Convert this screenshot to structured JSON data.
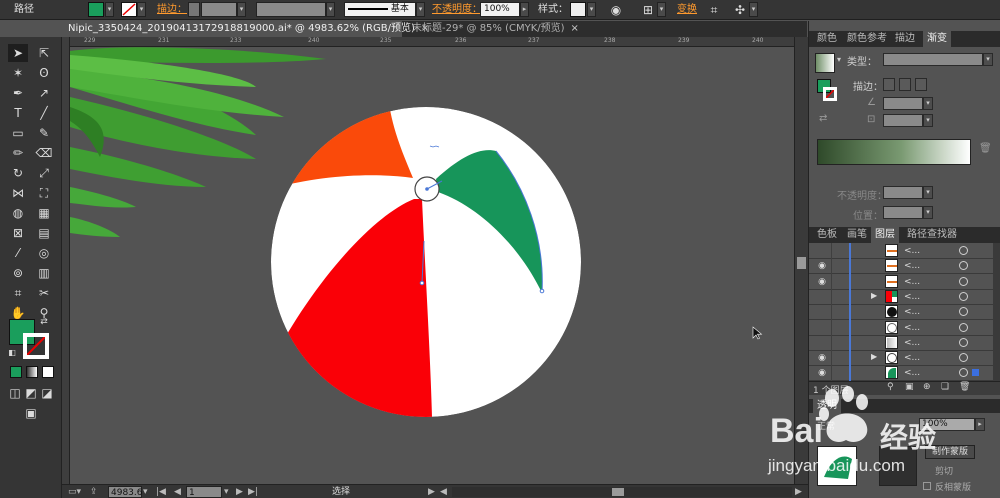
{
  "control_bar": {
    "object_type": "路径",
    "stroke_label": "描边：",
    "stroke_style": "基本",
    "opacity_label": "不透明度：",
    "opacity_value": "100%",
    "style_label": "样式：",
    "transform_label": "变换",
    "fill_color": "#1a9e5c"
  },
  "doc_tabs": [
    {
      "label": "Nipic_3350424_20190413172918819000.ai* @ 4983.62% (RGB/预览)",
      "close": "×"
    },
    {
      "label": "未标题-29* @ 85% (CMYK/预览)",
      "close": "×"
    }
  ],
  "rulers": {
    "top": [
      "229",
      "231",
      "233",
      "240",
      "235",
      "236",
      "237",
      "238",
      "239",
      "240"
    ]
  },
  "status_bar": {
    "zoom": "4983.6",
    "page": "1",
    "tool_status": "选择"
  },
  "toolbar": {
    "fill_color": "#1a9e5c",
    "stroke_color": "#ffffff"
  },
  "gradient_panel": {
    "tabs": [
      "颜色",
      "颜色参考",
      "描边",
      "渐变"
    ],
    "type_label": "类型：",
    "stroke_label": "描边：",
    "opacity_label": "不透明度：",
    "location_label": "位置：",
    "gradient_colors": [
      "#2f4a2a",
      "#7a9a72",
      "#ffffff"
    ]
  },
  "layers_panel": {
    "tabs": [
      "色板",
      "画笔",
      "图层",
      "路径查找器"
    ],
    "rows": [
      {
        "name": "<...",
        "visible": false,
        "thumb": "line"
      },
      {
        "name": "<...",
        "visible": true,
        "thumb": "line"
      },
      {
        "name": "<...",
        "visible": true,
        "thumb": "line"
      },
      {
        "name": "<...",
        "visible": false,
        "thumb": "red",
        "expandable": true
      },
      {
        "name": "<...",
        "visible": false,
        "thumb": "black"
      },
      {
        "name": "<...",
        "visible": false,
        "thumb": "white"
      },
      {
        "name": "<...",
        "visible": false,
        "thumb": "gray"
      },
      {
        "name": "<...",
        "visible": true,
        "thumb": "circle",
        "expandable": true
      },
      {
        "name": "<...",
        "visible": true,
        "thumb": "green",
        "selected": true
      }
    ],
    "footer_count": "1 个图层"
  },
  "transparency_panel": {
    "tab": "透明",
    "mode": "正常",
    "opacity": "100%",
    "make_mask": "制作蒙版",
    "clip": "剪切",
    "invert_mask": "反相蒙版"
  },
  "watermark": {
    "brand": "Bai",
    "brand_cn": "经验",
    "url": "jingyan.baidu.com"
  },
  "colors": {
    "ball_red": "#fa0007",
    "ball_orange": "#fa4a0a",
    "ball_green": "#17955a",
    "leaf_green": "#46a83a"
  }
}
